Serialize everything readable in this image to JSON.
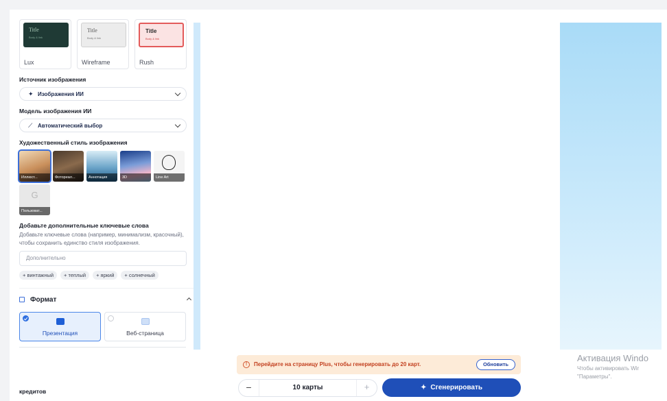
{
  "themes": [
    {
      "name": "Lux",
      "thumb_title": "Title",
      "thumb_body": "Body & link"
    },
    {
      "name": "Wireframe",
      "thumb_title": "Title",
      "thumb_body": "Body & link"
    },
    {
      "name": "Rush",
      "thumb_title": "Title",
      "thumb_body": "Body & link"
    }
  ],
  "image_source": {
    "label": "Источник изображения",
    "value": "Изображения ИИ",
    "icon": "sparkle-icon"
  },
  "image_model": {
    "label": "Модель изображения ИИ",
    "value": "Автоматический выбор",
    "icon": "magic-wand-icon"
  },
  "art_style": {
    "label": "Художественный стиль изображения",
    "tiles": [
      {
        "caption": "Иллюст...",
        "selected": true
      },
      {
        "caption": "Фотореал..."
      },
      {
        "caption": "Аннотация"
      },
      {
        "caption": "3D"
      },
      {
        "caption": "Line Art"
      },
      {
        "caption": "Пользоват...",
        "glyph": "G"
      }
    ]
  },
  "keywords": {
    "title": "Добавьте дополнительные ключевые слова",
    "description": "Добавьте ключевые слова (например, минимализм, красочный), чтобы сохранить единство стиля изображения.",
    "placeholder": "Дополнительно",
    "chips": [
      "+ винтажный",
      "+ теплый",
      "+ яркий",
      "+ солнечный"
    ]
  },
  "format": {
    "label": "Формат",
    "options": [
      {
        "label": "Презентация",
        "selected": true
      },
      {
        "label": "Веб-страница",
        "selected": false
      }
    ]
  },
  "credits_label": "кредитов",
  "notice": {
    "text": "Перейдите на страницу Plus, чтобы генерировать до 20 карт.",
    "button": "Обновить"
  },
  "stepper": {
    "minus": "−",
    "value": "10 карты",
    "plus": "+"
  },
  "generate": {
    "label": "Сгенерировать"
  },
  "watermark": {
    "title": "Активация Windo",
    "line1": "Чтобы активировать Wir",
    "line2": "\"Параметры\"."
  },
  "colors": {
    "accent": "#1f4fb8",
    "selection": "#4a86e8",
    "notice_bg": "#fdebd8",
    "notice_text": "#c23f1e",
    "preview_blue": "#a9dbf7"
  }
}
